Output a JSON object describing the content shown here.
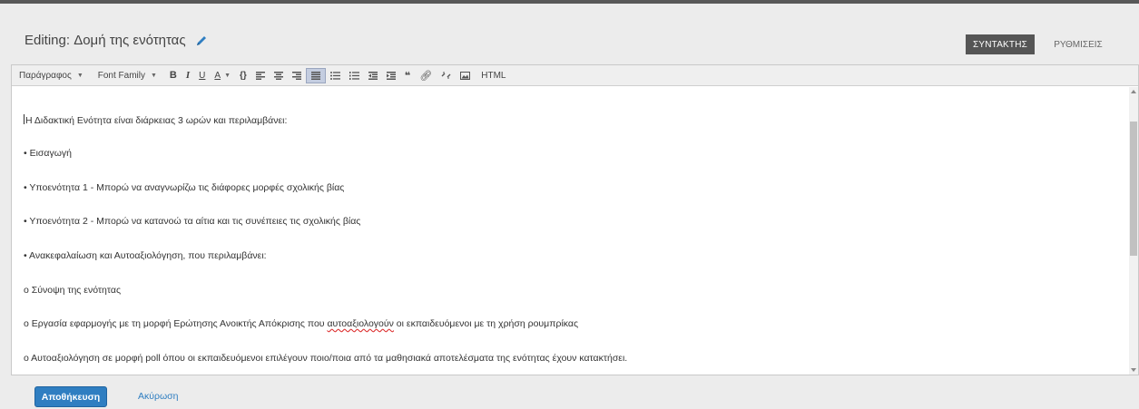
{
  "header": {
    "title": "Editing: Δομή της ενότητας",
    "tabs": {
      "editor": "ΣΥΝΤΑΚΤΗΣ",
      "settings": "ΡΥΘΜΙΣΕΙΣ"
    }
  },
  "toolbar": {
    "paragraph": "Παράγραφος",
    "font_family": "Font Family",
    "html": "HTML",
    "icons": [
      "bold-icon",
      "italic-icon",
      "underline-icon",
      "text-color-icon",
      "code-icon",
      "align-left-icon",
      "align-center-icon",
      "align-right-icon",
      "align-justify-icon",
      "bullet-list-icon",
      "numbered-list-icon",
      "outdent-icon",
      "indent-icon",
      "blockquote-icon",
      "link-icon",
      "unlink-icon",
      "image-icon"
    ]
  },
  "content": {
    "lines": [
      "Η Διδακτική Ενότητα είναι διάρκειας 3 ωρών και περιλαμβάνει:",
      "• Εισαγωγή",
      "• Υποενότητα 1 - Μπορώ να αναγνωρίζω τις διάφορες μορφές σχολικής βίας",
      "• Υποενότητα 2 -  Μπορώ να κατανοώ τα αίτια και τις συνέπειες τις σχολικής βίας",
      "• Ανακεφαλαίωση και Αυτοαξιολόγηση, που περιλαμβάνει:",
      "ο Σύνοψη της ενότητας",
      "ο Αυτοαξιολόγηση σε μορφή poll όπου οι εκπαιδευόμενοι επιλέγουν ποιο/ποια από τα μαθησιακά αποτελέσματα της ενότητας έχουν κατακτήσει."
    ],
    "line7_before": "ο Εργασία εφαρμογής με τη μορφή Ερώτησης Ανοικτής Απόκρισης που ",
    "line7_misspelled": "αυτοαξιολογούν",
    "line7_after": " οι εκπαιδευόμενοι με τη χρήση ρουμπρίκας"
  },
  "footer": {
    "save": "Αποθήκευση",
    "cancel": "Ακύρωση"
  },
  "colors": {
    "accent": "#2f7ec1",
    "tab_active": "#555555",
    "top_border": "#585858"
  }
}
